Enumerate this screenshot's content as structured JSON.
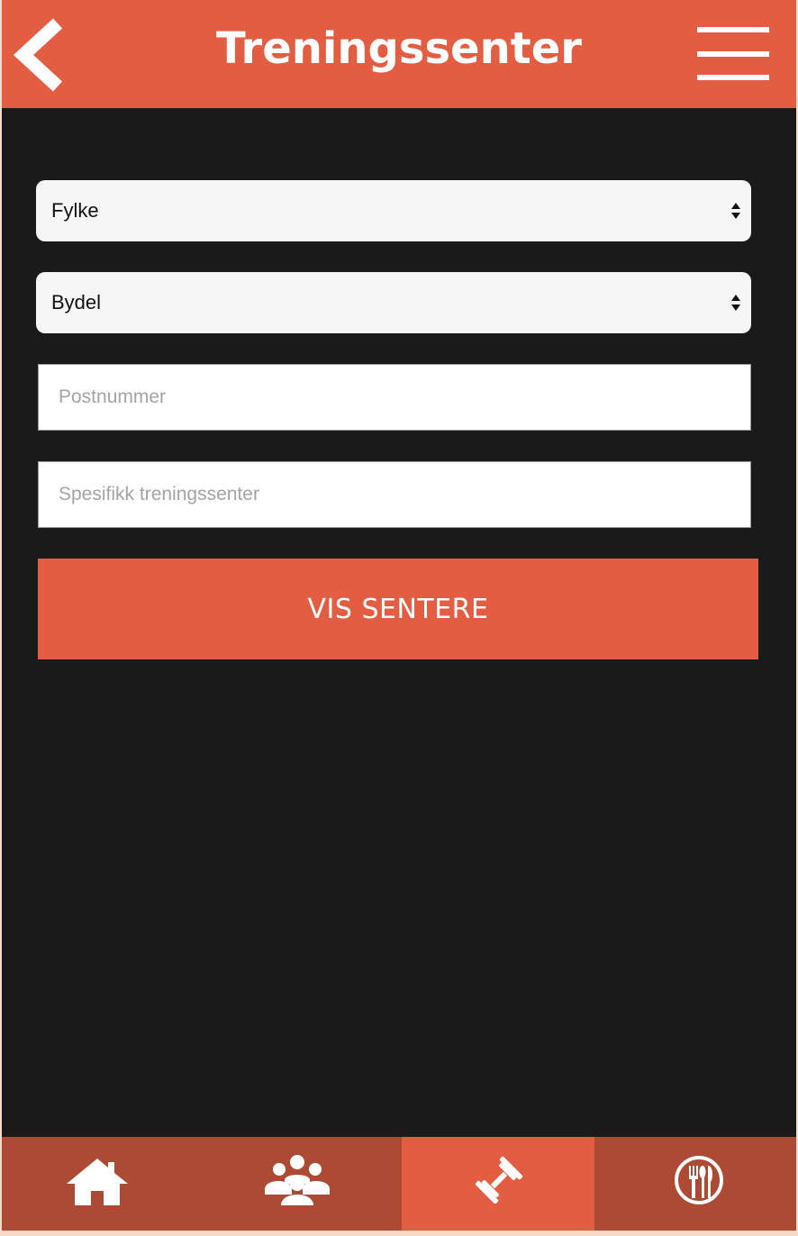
{
  "header": {
    "title": "Treningssenter",
    "back_icon": "chevron-left-icon",
    "menu_icon": "hamburger-menu-icon"
  },
  "form": {
    "county_select": {
      "value": "Fylke"
    },
    "district_select": {
      "value": "Bydel"
    },
    "postal_code_input": {
      "placeholder": "Postnummer",
      "value": ""
    },
    "gym_name_input": {
      "placeholder": "Spesifikk treningssenter",
      "value": ""
    },
    "submit_label": "VIS SENTERE"
  },
  "bottom_nav": {
    "items": [
      {
        "icon": "home-icon",
        "active": false
      },
      {
        "icon": "group-icon",
        "active": false
      },
      {
        "icon": "dumbbell-icon",
        "active": true
      },
      {
        "icon": "restaurant-icon",
        "active": false
      }
    ]
  },
  "colors": {
    "accent": "#e35d42",
    "nav_background": "#ad4a33",
    "page_background": "#1b1a1a"
  }
}
